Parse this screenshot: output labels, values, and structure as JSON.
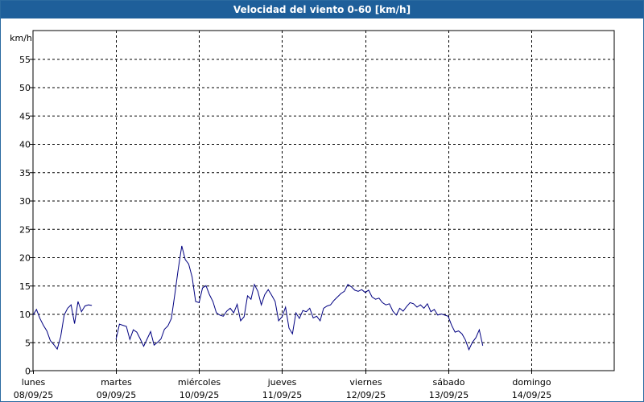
{
  "window": {
    "title": "Velocidad del viento 0-60 [km/h]"
  },
  "chart_data": {
    "type": "line",
    "title": "Velocidad del viento 0-60 [km/h]",
    "ylabel": "km/h",
    "ylim": [
      0,
      60
    ],
    "yticks": [
      0,
      5,
      10,
      15,
      20,
      25,
      30,
      35,
      40,
      45,
      50,
      55
    ],
    "xlim_days": [
      0,
      7
    ],
    "grid": true,
    "line_color": "#000080",
    "x_ticks": [
      {
        "day": "lunes",
        "date": "08/09/25"
      },
      {
        "day": "martes",
        "date": "09/09/25"
      },
      {
        "day": "miércoles",
        "date": "10/09/25"
      },
      {
        "day": "jueves",
        "date": "11/09/25"
      },
      {
        "day": "viernes",
        "date": "12/09/25"
      },
      {
        "day": "sábado",
        "date": "13/09/25"
      },
      {
        "day": "domingo",
        "date": "14/09/25"
      }
    ],
    "series": [
      {
        "segments": [
          [
            [
              "2025-09-08 00:00",
              9.8
            ],
            [
              "2025-09-08 01:00",
              10.8
            ],
            [
              "2025-09-08 02:00",
              9.2
            ],
            [
              "2025-09-08 03:00",
              8.0
            ],
            [
              "2025-09-08 04:00",
              7.0
            ],
            [
              "2025-09-08 05:00",
              5.3
            ],
            [
              "2025-09-08 06:00",
              4.6
            ],
            [
              "2025-09-08 07:00",
              3.8
            ],
            [
              "2025-09-08 08:00",
              6.0
            ],
            [
              "2025-09-08 09:00",
              9.8
            ],
            [
              "2025-09-08 10:00",
              11.0
            ],
            [
              "2025-09-08 11:00",
              11.6
            ],
            [
              "2025-09-08 12:00",
              8.3
            ],
            [
              "2025-09-08 13:00",
              12.2
            ],
            [
              "2025-09-08 14:00",
              10.4
            ],
            [
              "2025-09-08 15:00",
              11.4
            ],
            [
              "2025-09-08 16:00",
              11.6
            ],
            [
              "2025-09-08 17:00",
              11.5
            ]
          ],
          [
            [
              "2025-09-09 00:00",
              5.5
            ],
            [
              "2025-09-09 01:00",
              8.2
            ],
            [
              "2025-09-09 02:00",
              8.0
            ],
            [
              "2025-09-09 03:00",
              7.8
            ],
            [
              "2025-09-09 04:00",
              5.5
            ],
            [
              "2025-09-09 05:00",
              7.2
            ],
            [
              "2025-09-09 06:00",
              6.8
            ],
            [
              "2025-09-09 07:00",
              5.6
            ],
            [
              "2025-09-09 08:00",
              4.3
            ],
            [
              "2025-09-09 09:00",
              5.6
            ],
            [
              "2025-09-09 10:00",
              6.9
            ],
            [
              "2025-09-09 11:00",
              4.5
            ],
            [
              "2025-09-09 12:00",
              5.0
            ],
            [
              "2025-09-09 13:00",
              5.6
            ],
            [
              "2025-09-09 14:00",
              7.3
            ],
            [
              "2025-09-09 15:00",
              7.9
            ],
            [
              "2025-09-09 16:00",
              9.2
            ],
            [
              "2025-09-09 17:00",
              13.5
            ],
            [
              "2025-09-09 18:00",
              18.0
            ],
            [
              "2025-09-09 19:00",
              22.0
            ],
            [
              "2025-09-09 20:00",
              19.6
            ],
            [
              "2025-09-09 21:00",
              18.8
            ],
            [
              "2025-09-09 22:00",
              16.5
            ],
            [
              "2025-09-09 23:00",
              12.2
            ],
            [
              "2025-09-10 00:00",
              12.0
            ],
            [
              "2025-09-10 01:00",
              14.6
            ],
            [
              "2025-09-10 02:00",
              15.0
            ],
            [
              "2025-09-10 03:00",
              13.4
            ],
            [
              "2025-09-10 04:00",
              12.2
            ],
            [
              "2025-09-10 05:00",
              10.2
            ],
            [
              "2025-09-10 06:00",
              9.8
            ],
            [
              "2025-09-10 07:00",
              9.6
            ],
            [
              "2025-09-10 08:00",
              10.5
            ],
            [
              "2025-09-10 09:00",
              11.0
            ],
            [
              "2025-09-10 10:00",
              10.2
            ],
            [
              "2025-09-10 11:00",
              11.7
            ],
            [
              "2025-09-10 12:00",
              8.8
            ],
            [
              "2025-09-10 13:00",
              9.5
            ],
            [
              "2025-09-10 14:00",
              13.2
            ],
            [
              "2025-09-10 15:00",
              12.6
            ],
            [
              "2025-09-10 16:00",
              15.2
            ],
            [
              "2025-09-10 17:00",
              14.0
            ],
            [
              "2025-09-10 18:00",
              11.6
            ],
            [
              "2025-09-10 19:00",
              13.4
            ],
            [
              "2025-09-10 20:00",
              14.3
            ],
            [
              "2025-09-10 21:00",
              13.3
            ],
            [
              "2025-09-10 22:00",
              12.2
            ],
            [
              "2025-09-10 23:00",
              8.8
            ],
            [
              "2025-09-11 00:00",
              9.5
            ],
            [
              "2025-09-11 01:00",
              11.2
            ],
            [
              "2025-09-11 02:00",
              7.5
            ],
            [
              "2025-09-11 03:00",
              6.5
            ],
            [
              "2025-09-11 04:00",
              10.2
            ],
            [
              "2025-09-11 05:00",
              9.2
            ],
            [
              "2025-09-11 06:00",
              10.6
            ],
            [
              "2025-09-11 07:00",
              10.4
            ],
            [
              "2025-09-11 08:00",
              11.0
            ],
            [
              "2025-09-11 09:00",
              9.3
            ],
            [
              "2025-09-11 10:00",
              9.6
            ],
            [
              "2025-09-11 11:00",
              8.8
            ],
            [
              "2025-09-11 12:00",
              11.0
            ],
            [
              "2025-09-11 13:00",
              11.4
            ],
            [
              "2025-09-11 14:00",
              11.6
            ],
            [
              "2025-09-11 15:00",
              12.4
            ],
            [
              "2025-09-11 16:00",
              13.0
            ],
            [
              "2025-09-11 17:00",
              13.6
            ],
            [
              "2025-09-11 18:00",
              14.0
            ],
            [
              "2025-09-11 19:00",
              15.2
            ],
            [
              "2025-09-11 20:00",
              14.8
            ],
            [
              "2025-09-11 21:00",
              14.2
            ],
            [
              "2025-09-11 22:00",
              14.0
            ],
            [
              "2025-09-11 23:00",
              14.3
            ],
            [
              "2025-09-12 00:00",
              13.8
            ],
            [
              "2025-09-12 01:00",
              14.2
            ],
            [
              "2025-09-12 02:00",
              13.0
            ],
            [
              "2025-09-12 03:00",
              12.6
            ],
            [
              "2025-09-12 04:00",
              12.8
            ],
            [
              "2025-09-12 05:00",
              12.0
            ],
            [
              "2025-09-12 06:00",
              11.6
            ],
            [
              "2025-09-12 07:00",
              11.8
            ],
            [
              "2025-09-12 08:00",
              10.5
            ],
            [
              "2025-09-12 09:00",
              9.8
            ],
            [
              "2025-09-12 10:00",
              11.0
            ],
            [
              "2025-09-12 11:00",
              10.5
            ],
            [
              "2025-09-12 12:00",
              11.3
            ],
            [
              "2025-09-12 13:00",
              12.0
            ],
            [
              "2025-09-12 14:00",
              11.8
            ],
            [
              "2025-09-12 15:00",
              11.2
            ],
            [
              "2025-09-12 16:00",
              11.6
            ],
            [
              "2025-09-12 17:00",
              11.0
            ],
            [
              "2025-09-12 18:00",
              11.8
            ],
            [
              "2025-09-12 19:00",
              10.4
            ],
            [
              "2025-09-12 20:00",
              10.8
            ],
            [
              "2025-09-12 21:00",
              9.8
            ],
            [
              "2025-09-12 22:00",
              10.0
            ],
            [
              "2025-09-12 23:00",
              9.8
            ],
            [
              "2025-09-13 00:00",
              9.6
            ],
            [
              "2025-09-13 01:00",
              8.0
            ],
            [
              "2025-09-13 02:00",
              6.8
            ],
            [
              "2025-09-13 03:00",
              7.0
            ],
            [
              "2025-09-13 04:00",
              6.5
            ],
            [
              "2025-09-13 05:00",
              5.4
            ],
            [
              "2025-09-13 06:00",
              3.7
            ],
            [
              "2025-09-13 07:00",
              5.0
            ],
            [
              "2025-09-13 08:00",
              5.8
            ],
            [
              "2025-09-13 09:00",
              7.2
            ],
            [
              "2025-09-13 10:00",
              4.4
            ]
          ]
        ]
      }
    ]
  }
}
